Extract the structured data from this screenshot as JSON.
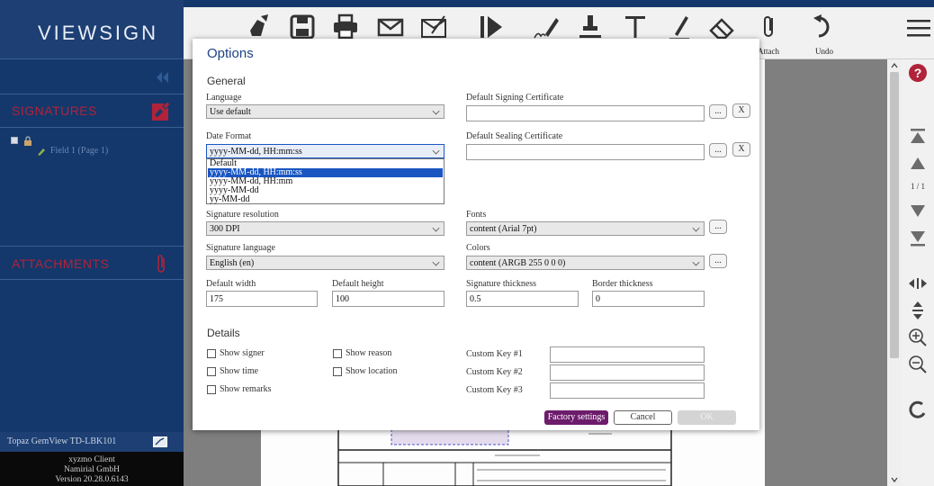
{
  "app": {
    "logo_text": "VIEWSIGN",
    "accent_color": "#14386b",
    "brand_red": "#b0233a"
  },
  "sidebar": {
    "signatures_label": "SIGNATURES",
    "field_item_label": "Field 1 (Page 1)",
    "attachments_label": "ATTACHMENTS",
    "device_label": "Topaz GemView TD-LBK101",
    "version_lines": [
      "xyzmo Client",
      "Namirial GmbH",
      "Version 20.28.0.6143"
    ]
  },
  "toolbar": {
    "items": [
      {
        "icon": "hand-edit-icon",
        "label": ""
      },
      {
        "icon": "save-icon",
        "label": ""
      },
      {
        "icon": "print-icon",
        "label": ""
      },
      {
        "icon": "mail-icon",
        "label": ""
      },
      {
        "icon": "mail-sign-icon",
        "label": ""
      },
      {
        "icon": "next-field-icon",
        "label": ""
      },
      {
        "icon": "pen-sign-icon",
        "label": ""
      },
      {
        "icon": "stamp-icon",
        "label": ""
      },
      {
        "icon": "text-icon",
        "label": ""
      },
      {
        "icon": "freehand-icon",
        "label": ""
      },
      {
        "icon": "eraser-icon",
        "label": ""
      },
      {
        "icon": "attach-icon",
        "label": "Attach"
      },
      {
        "icon": "undo-icon",
        "label": "Undo"
      }
    ]
  },
  "viewer": {
    "page_indicator": "1 / 1"
  },
  "dialog": {
    "title": "Options",
    "general_title": "General",
    "details_title": "Details",
    "language": {
      "label": "Language",
      "value": "Use default"
    },
    "date_format": {
      "label": "Date Format",
      "value": "yyyy-MM-dd, HH:mm:ss",
      "options": [
        "Default",
        "yyyy-MM-dd, HH:mm:ss",
        "yyyy-MM-dd, HH:mm",
        "yyyy-MM-dd",
        "yy-MM-dd"
      ],
      "selected_index": 1
    },
    "signing_cert": {
      "label": "Default Signing Certificate",
      "value": "",
      "browse": "...",
      "clear": "X"
    },
    "sealing_cert": {
      "label": "Default Sealing Certificate",
      "value": "",
      "browse": "...",
      "clear": "X"
    },
    "sig_resolution": {
      "label": "Signature resolution",
      "value": "300 DPI"
    },
    "sig_language": {
      "label": "Signature language",
      "value": "English (en)"
    },
    "fonts": {
      "label": "Fonts",
      "value": "content (Arial 7pt)",
      "browse": "..."
    },
    "colors": {
      "label": "Colors",
      "value": "content (ARGB 255 0 0 0)",
      "browse": "..."
    },
    "default_width": {
      "label": "Default width",
      "value": "175"
    },
    "default_height": {
      "label": "Default height",
      "value": "100"
    },
    "sig_thickness": {
      "label": "Signature thickness",
      "value": "0.5"
    },
    "border_thickness": {
      "label": "Border thickness",
      "value": "0"
    },
    "details": {
      "show_signer": "Show signer",
      "show_reason": "Show reason",
      "show_time": "Show time",
      "show_location": "Show location",
      "show_remarks": "Show remarks",
      "custom_key1": "Custom Key #1",
      "custom_key2": "Custom Key #2",
      "custom_key3": "Custom Key #3"
    },
    "buttons": {
      "factory": "Factory settings",
      "cancel": "Cancel",
      "ok": "OK"
    }
  }
}
